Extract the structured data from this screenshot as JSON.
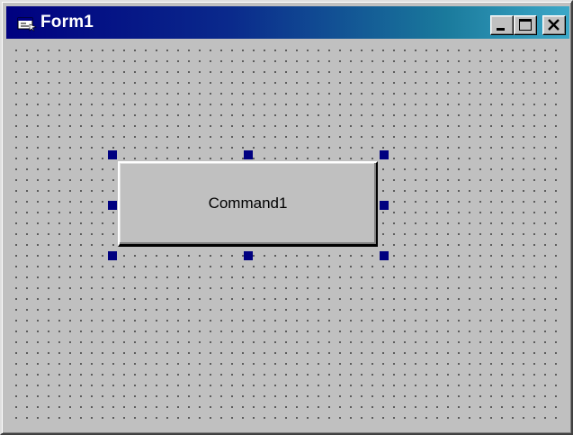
{
  "window": {
    "title": "Form1",
    "icon": "form-icon",
    "controls": {
      "minimize": "minimize-icon",
      "maximize": "maximize-icon",
      "close": "close-icon"
    }
  },
  "form": {
    "grid": "dotted",
    "selected_control": {
      "type": "CommandButton",
      "caption": "Command1"
    }
  },
  "colors": {
    "titlebar_start": "#000080",
    "titlebar_end": "#3ca8c8",
    "face": "#c0c0c0",
    "handle": "#000080"
  }
}
